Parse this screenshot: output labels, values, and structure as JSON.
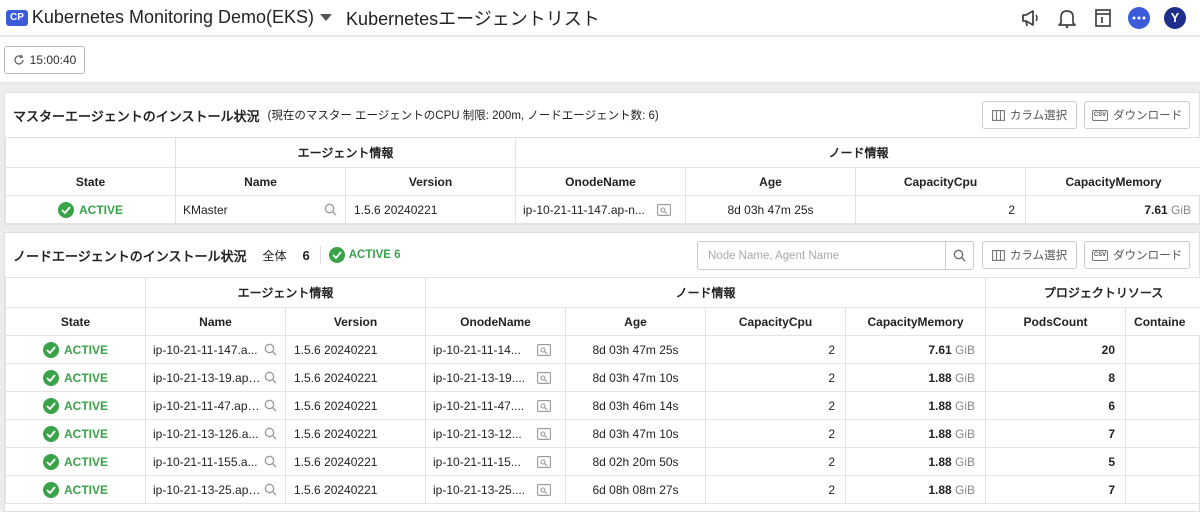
{
  "header": {
    "badge": "CP",
    "project_name": "Kubernetes Monitoring Demo(EKS)",
    "page_title": "Kubernetesエージェントリスト",
    "avatar_letter": "Y",
    "icons": [
      "megaphone-icon",
      "bell-icon",
      "document-icon",
      "chat-icon"
    ]
  },
  "toolbar": {
    "time": "15:00:40"
  },
  "master": {
    "title": "マスターエージェントのインストール状況",
    "subtitle": "(現在のマスター エージェントのCPU 制限: 200m, ノードエージェント数: 6)",
    "column_select_label": "カラム選択",
    "download_label": "ダウンロード",
    "group_headers": {
      "agent": "エージェント情報",
      "node": "ノード情報"
    },
    "columns": [
      "State",
      "Name",
      "Version",
      "OnodeName",
      "Age",
      "CapacityCpu",
      "CapacityMemory"
    ],
    "rows": [
      {
        "state": "ACTIVE",
        "name": "KMaster",
        "version": "1.5.6 20240221",
        "onode": "ip-10-21-11-147.ap-n...",
        "age": "8d 03h 47m 25s",
        "cpu": "2",
        "mem": "7.61",
        "unit": "GiB"
      }
    ]
  },
  "node": {
    "title": "ノードエージェントのインストール状況",
    "total_label": "全体",
    "total_value": "6",
    "active_label": "ACTIVE 6",
    "search_placeholder": "Node Name, Agent Name",
    "column_select_label": "カラム選択",
    "download_label": "ダウンロード",
    "group_headers": {
      "agent": "エージェント情報",
      "node": "ノード情報",
      "project": "プロジェクトリソース"
    },
    "columns": [
      "State",
      "Name",
      "Version",
      "OnodeName",
      "Age",
      "CapacityCpu",
      "CapacityMemory",
      "PodsCount",
      "Containe"
    ],
    "rows": [
      {
        "state": "ACTIVE",
        "name": "ip-10-21-11-147.a...",
        "version": "1.5.6 20240221",
        "onode": "ip-10-21-11-14...",
        "age": "8d 03h 47m 25s",
        "cpu": "2",
        "mem": "7.61",
        "unit": "GiB",
        "pods": "20"
      },
      {
        "state": "ACTIVE",
        "name": "ip-10-21-13-19.ap-...",
        "version": "1.5.6 20240221",
        "onode": "ip-10-21-13-19....",
        "age": "8d 03h 47m 10s",
        "cpu": "2",
        "mem": "1.88",
        "unit": "GiB",
        "pods": "8"
      },
      {
        "state": "ACTIVE",
        "name": "ip-10-21-11-47.ap-...",
        "version": "1.5.6 20240221",
        "onode": "ip-10-21-11-47....",
        "age": "8d 03h 46m 14s",
        "cpu": "2",
        "mem": "1.88",
        "unit": "GiB",
        "pods": "6"
      },
      {
        "state": "ACTIVE",
        "name": "ip-10-21-13-126.a...",
        "version": "1.5.6 20240221",
        "onode": "ip-10-21-13-12...",
        "age": "8d 03h 47m 10s",
        "cpu": "2",
        "mem": "1.88",
        "unit": "GiB",
        "pods": "7"
      },
      {
        "state": "ACTIVE",
        "name": "ip-10-21-11-155.a...",
        "version": "1.5.6 20240221",
        "onode": "ip-10-21-11-15...",
        "age": "8d 02h 20m 50s",
        "cpu": "2",
        "mem": "1.88",
        "unit": "GiB",
        "pods": "5"
      },
      {
        "state": "ACTIVE",
        "name": "ip-10-21-13-25.ap-...",
        "version": "1.5.6 20240221",
        "onode": "ip-10-21-13-25....",
        "age": "6d 08h 08m 27s",
        "cpu": "2",
        "mem": "1.88",
        "unit": "GiB",
        "pods": "7"
      }
    ]
  },
  "colors": {
    "accent": "#3b5bd9",
    "active": "#3aa34a",
    "avatar": "#1f2e8a"
  }
}
